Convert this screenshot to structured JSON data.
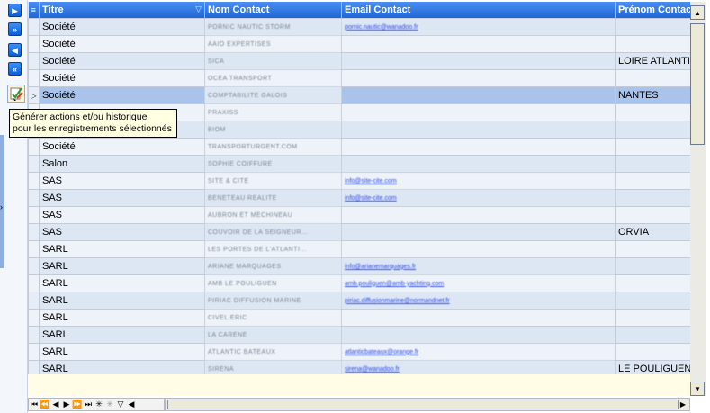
{
  "toolbar": {
    "first_icon": "arrow-right-icon",
    "next_icon": "double-arrow-right-icon",
    "prev_icon": "arrow-left-icon",
    "last_icon": "double-arrow-left-icon",
    "generate_icon": "generate-actions-icon"
  },
  "tooltip": {
    "line1": "Générer actions et/ou historique",
    "line2": "pour les enregistrements sélectionnés"
  },
  "grid": {
    "columns": [
      "Titre",
      "Nom Contact",
      "Email Contact",
      "Prénom Contac"
    ],
    "rows": [
      {
        "titre": "Société",
        "nom": "PORNIC NAUTIC STORM",
        "email": "pornic.nautic@wanadoo.fr",
        "prenom": ""
      },
      {
        "titre": "Société",
        "nom": "AAIO EXPERTISES",
        "email": "",
        "prenom": ""
      },
      {
        "titre": "Société",
        "nom": "SICA",
        "email": "",
        "prenom": "LOIRE ATLANTIQ"
      },
      {
        "titre": "Société",
        "nom": "OCEA TRANSPORT",
        "email": "",
        "prenom": ""
      },
      {
        "titre": "Société",
        "nom": "COMPTABILITE GALOIS",
        "email": "",
        "prenom": "NANTES"
      },
      {
        "titre": "",
        "nom": "PRAXISS",
        "email": "",
        "prenom": ""
      },
      {
        "titre": "",
        "nom": "BIOM",
        "email": "",
        "prenom": ""
      },
      {
        "titre": "Société",
        "nom": "TRANSPORTURGENT.COM",
        "email": "",
        "prenom": ""
      },
      {
        "titre": "Salon",
        "nom": "SOPHIE COIFFURE",
        "email": "",
        "prenom": ""
      },
      {
        "titre": "SAS",
        "nom": "SITE & CITE",
        "email": "info@site-cite.com",
        "prenom": ""
      },
      {
        "titre": "SAS",
        "nom": "BENETEAU REALITE",
        "email": "info@site-cite.com",
        "prenom": ""
      },
      {
        "titre": "SAS",
        "nom": "AUBRON ET MECHINEAU",
        "email": "",
        "prenom": ""
      },
      {
        "titre": "SAS",
        "nom": "COUVOIR DE LA SEIGNEUR...",
        "email": "",
        "prenom": "ORVIA"
      },
      {
        "titre": "SARL",
        "nom": "LES PORTES DE L'ATLANTI...",
        "email": "",
        "prenom": ""
      },
      {
        "titre": "SARL",
        "nom": "ARIANE MARQUAGES",
        "email": "info@arianemarquages.fr",
        "prenom": ""
      },
      {
        "titre": "SARL",
        "nom": "AMB LE POULIGUEN",
        "email": "amb.pouliguen@amb-yachting.com",
        "prenom": ""
      },
      {
        "titre": "SARL",
        "nom": "PIRIAC DIFFUSION MARINE",
        "email": "piriac.diffusionmarine@normandnet.fr",
        "prenom": ""
      },
      {
        "titre": "SARL",
        "nom": "CIVEL ERIC",
        "email": "",
        "prenom": ""
      },
      {
        "titre": "SARL",
        "nom": "LA CARENE",
        "email": "",
        "prenom": ""
      },
      {
        "titre": "SARL",
        "nom": "ATLANTIC BATEAUX",
        "email": "atlanticbateaux@orange.fr",
        "prenom": ""
      },
      {
        "titre": "SARL",
        "nom": "SIRENA",
        "email": "sirena@wanadoo.fr",
        "prenom": "LE POULIGUEN"
      }
    ]
  },
  "navigator": {
    "icons": [
      "first-record-icon",
      "prev-page-icon",
      "prev-record-icon",
      "next-record-icon",
      "next-page-icon",
      "last-record-icon",
      "insert-icon",
      "delete-icon",
      "filter-icon",
      "scroll-left-icon"
    ]
  }
}
